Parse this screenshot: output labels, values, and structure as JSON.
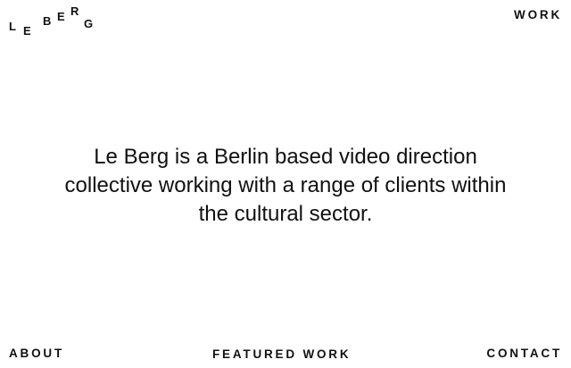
{
  "logo": {
    "letters": [
      "L",
      "E",
      "B",
      "E",
      "R",
      "G"
    ]
  },
  "nav": {
    "work": "WORK",
    "about": "ABOUT",
    "featured_work": "FEATURED WORK",
    "contact": "CONTACT"
  },
  "main": {
    "intro_text": "Le Berg is a Berlin based video direction collective working with a range of clients within the cultural sector."
  }
}
